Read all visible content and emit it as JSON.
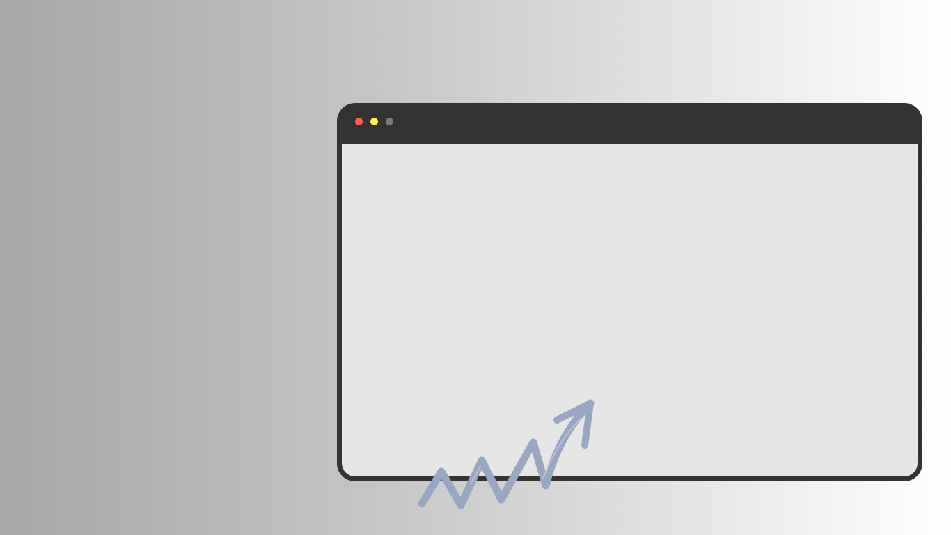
{
  "window": {
    "frame_color": "#333333",
    "content_color": "#e6e6e6",
    "controls": [
      {
        "name": "close",
        "color": "#ff5f57"
      },
      {
        "name": "minimize",
        "color": "#ffee58"
      },
      {
        "name": "zoom",
        "color": "#7a7a7a"
      }
    ]
  },
  "decoration": {
    "icon": "trend-up-arrow-icon",
    "color": "#9aa7c2"
  }
}
